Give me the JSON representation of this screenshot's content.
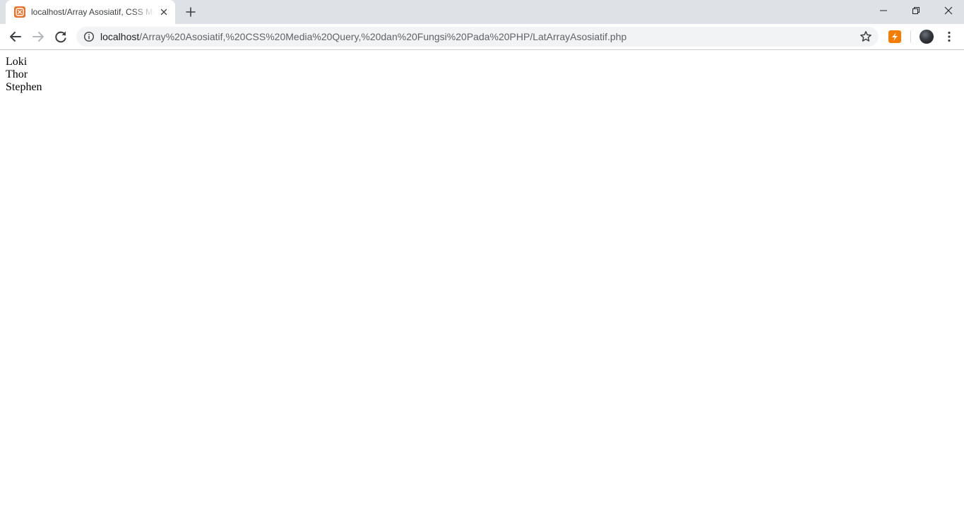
{
  "browser": {
    "tab": {
      "title": "localhost/Array Asosiatif, CSS Media Query, dan Fungsi Pada PHP",
      "favicon": "xampp-icon"
    },
    "url": {
      "host": "localhost",
      "path": "/Array%20Asosiatif,%20CSS%20Media%20Query,%20dan%20Fungsi%20Pada%20PHP/LatArrayAsosiatif.php"
    },
    "icons": {
      "back": "back-arrow-icon",
      "forward": "forward-arrow-icon",
      "reload": "reload-icon",
      "info": "info-icon",
      "bookmark": "star-icon",
      "extension": "extension-icon",
      "profile": "avatar",
      "menu": "kebab-menu-icon"
    },
    "colors": {
      "tab_strip": "#dee1e6",
      "omnibox": "#f1f3f4",
      "favicon": "#e8712b",
      "extension": "#f57c00"
    }
  },
  "page": {
    "names": [
      "Loki",
      "Thor",
      "Stephen"
    ]
  }
}
